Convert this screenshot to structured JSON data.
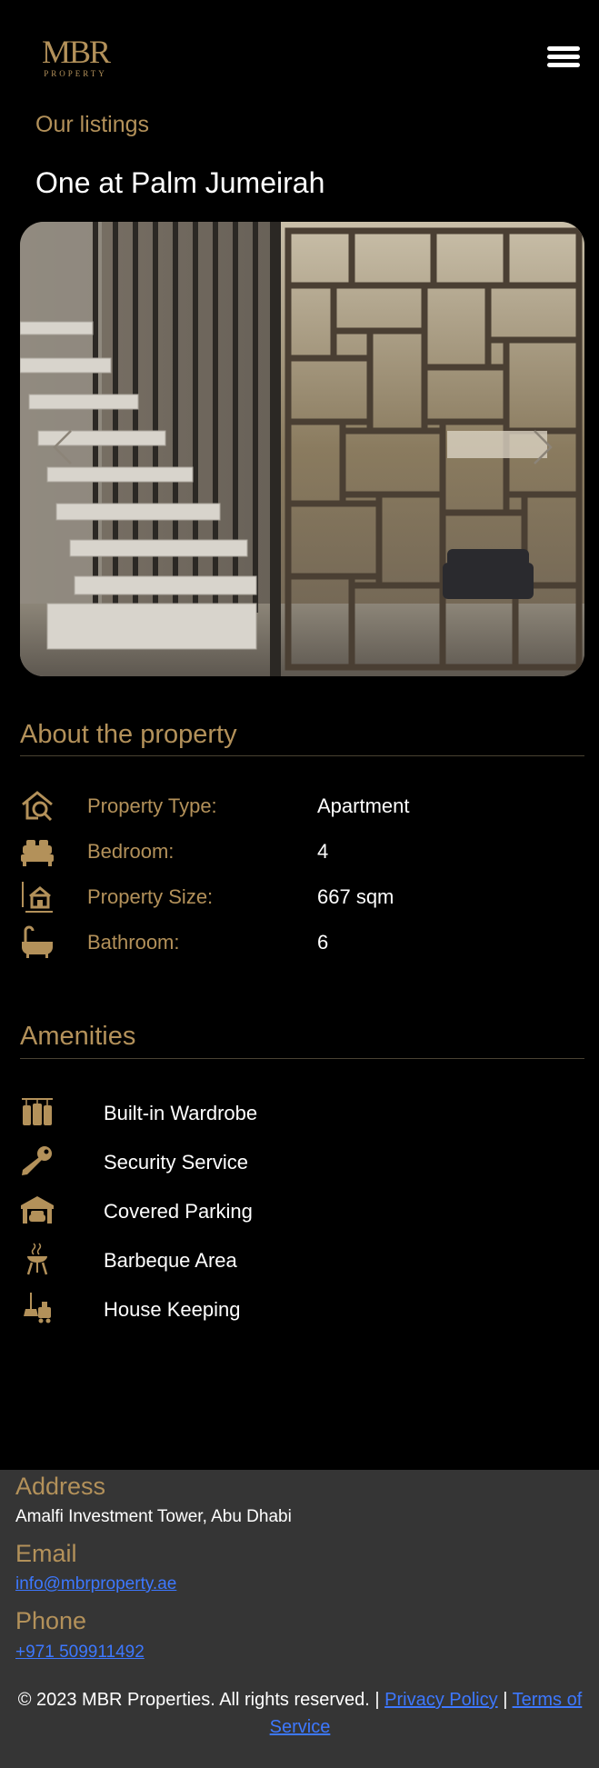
{
  "header": {
    "logo_mark": "MBR",
    "logo_sub": "PROPERTY",
    "menu_icon": "hamburger-menu-icon"
  },
  "listing": {
    "eyebrow": "Our listings",
    "title": "One at Palm Jumeirah"
  },
  "gallery": {
    "prev_icon": "chevron-left-icon",
    "next_icon": "chevron-right-icon"
  },
  "about": {
    "heading": "About the property",
    "specs": [
      {
        "icon": "house-search-icon",
        "label": "Property Type:",
        "value": "Apartment"
      },
      {
        "icon": "bed-icon",
        "label": "Bedroom:",
        "value": "4"
      },
      {
        "icon": "house-size-icon",
        "label": "Property Size:",
        "value": "667 sqm"
      },
      {
        "icon": "bathtub-icon",
        "label": "Bathroom:",
        "value": "6"
      }
    ]
  },
  "amenities": {
    "heading": "Amenities",
    "items": [
      {
        "icon": "wardrobe-icon",
        "label": "Built-in Wardrobe"
      },
      {
        "icon": "key-icon",
        "label": "Security Service"
      },
      {
        "icon": "garage-icon",
        "label": "Covered Parking"
      },
      {
        "icon": "barbeque-icon",
        "label": "Barbeque Area"
      },
      {
        "icon": "housekeeping-icon",
        "label": "House Keeping"
      }
    ]
  },
  "footer": {
    "address_heading": "Address",
    "address": "Amalfi Investment Tower, Abu Dhabi",
    "email_heading": "Email",
    "email": "info@mbrproperty.ae",
    "phone_heading": "Phone",
    "phone": "+971 509911492",
    "copyright": "© 2023 MBR Properties. All rights reserved. |",
    "separator": "|",
    "privacy": "Privacy Policy",
    "terms": "Terms of Service"
  },
  "colors": {
    "gold": "#b3915a",
    "background": "#000000",
    "footer_bg": "#353535",
    "link": "#3d78ff"
  }
}
